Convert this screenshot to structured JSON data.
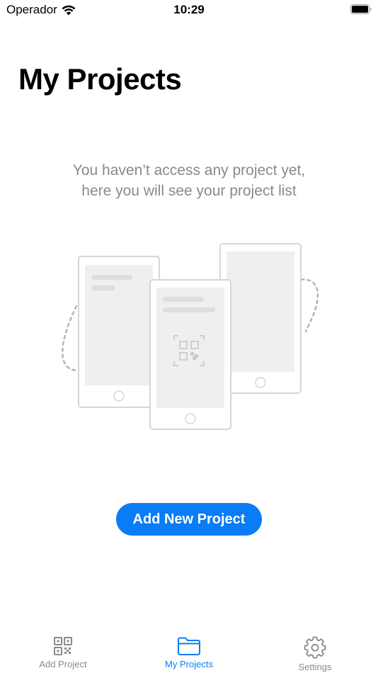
{
  "status_bar": {
    "carrier": "Operador",
    "time": "10:29"
  },
  "page": {
    "title": "My Projects",
    "empty_message_line1": "You haven’t access any project yet,",
    "empty_message_line2": "here you will see your project list"
  },
  "actions": {
    "add_new_project_label": "Add New Project"
  },
  "tab_bar": {
    "tabs": [
      {
        "label": "Add Project",
        "icon": "qr-code-icon",
        "active": false
      },
      {
        "label": "My Projects",
        "icon": "folder-icon",
        "active": true
      },
      {
        "label": "Settings",
        "icon": "gear-icon",
        "active": false
      }
    ]
  },
  "colors": {
    "accent": "#0a7cf5",
    "secondary_text": "#8a8a8e",
    "illustration_stroke": "#d6d6d6",
    "illustration_fill": "#efefef"
  }
}
